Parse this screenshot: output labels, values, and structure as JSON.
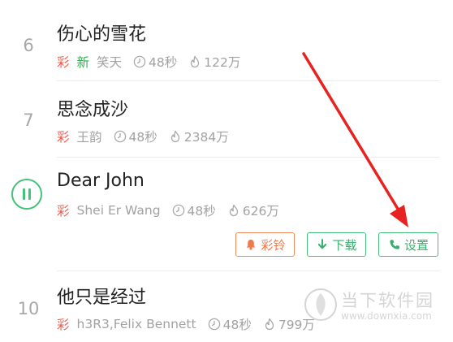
{
  "songs": [
    {
      "num": "6",
      "title": "伤心的雪花",
      "tag": "彩",
      "new_tag": "新",
      "artist": "笑天",
      "duration": "48秒",
      "plays": "122万"
    },
    {
      "num": "7",
      "title": "思念成沙",
      "tag": "彩",
      "artist": "王韵",
      "duration": "48秒",
      "plays": "2384万"
    },
    {
      "num": "",
      "title": "Dear John",
      "tag": "彩",
      "artist": "Shei Er Wang",
      "duration": "48秒",
      "plays": "626万"
    },
    {
      "num": "10",
      "title": "他只是经过",
      "tag": "彩",
      "artist": "h3R3,Felix Bennett",
      "duration": "48秒",
      "plays": "799万"
    }
  ],
  "actions": {
    "ringtone": "彩铃",
    "download": "下载",
    "set": "设置"
  },
  "watermark": {
    "name": "当下软件园",
    "url": "www.downxia.com"
  },
  "colors": {
    "accent_green": "#43c27a",
    "tag_red": "#f05b4b",
    "ring_orange": "#f08a5d",
    "arrow_red": "#e8231f"
  }
}
